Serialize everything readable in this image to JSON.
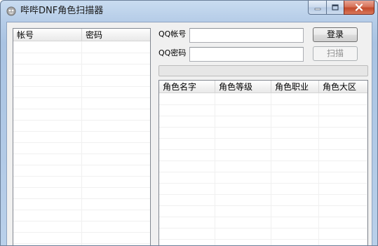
{
  "window": {
    "title": "哔哔DNF角色扫描器"
  },
  "account_list": {
    "columns": [
      "帐号",
      "密码"
    ],
    "rows": []
  },
  "login_form": {
    "qq_account_label": "QQ帐号",
    "qq_account_value": "",
    "qq_password_label": "QQ密码",
    "qq_password_value": "",
    "login_button": "登录",
    "scan_button": "扫描"
  },
  "progress": {
    "value": 0
  },
  "role_list": {
    "columns": [
      "角色名字",
      "角色等级",
      "角色职业",
      "角色大区"
    ],
    "rows": []
  }
}
